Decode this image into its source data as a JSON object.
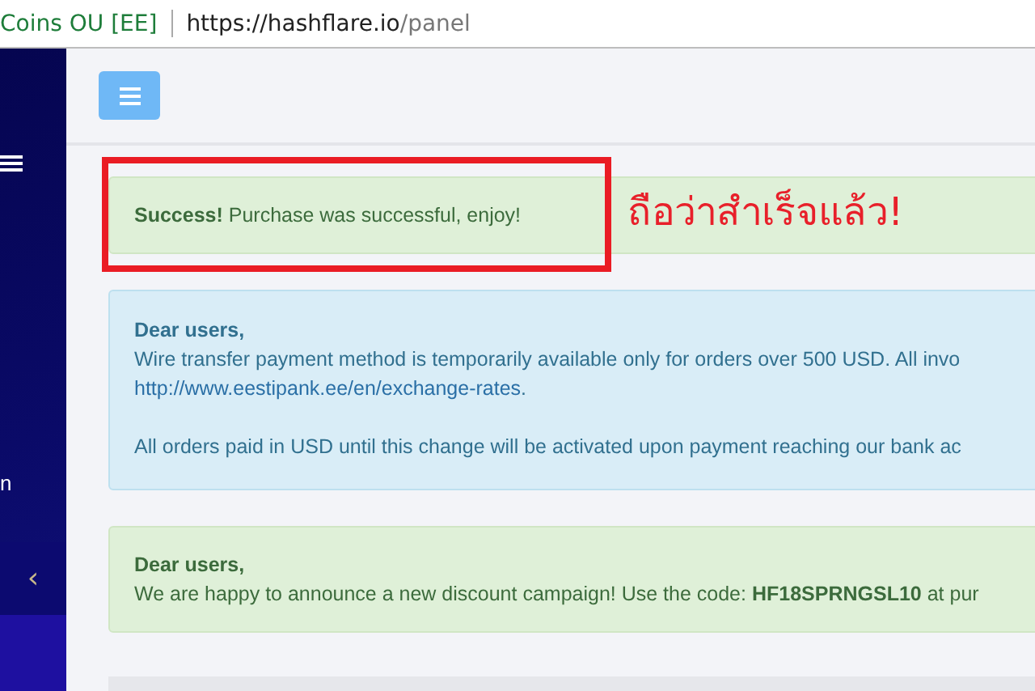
{
  "browser": {
    "site_identity": "Coins OU [EE]",
    "url_host": "https://hashflare.io",
    "url_path": "/panel"
  },
  "sidebar": {
    "label": "n",
    "collapse_glyph": "‹"
  },
  "alerts": [
    {
      "kind": "success",
      "lines": [
        [
          {
            "kind": "text",
            "text": "**Success!** Purchase was successful, enjoy!"
          }
        ]
      ]
    },
    {
      "kind": "info",
      "title": "Dear users,",
      "lines": [
        [
          {
            "kind": "text",
            "text": "Wire transfer payment method is temporarily available only for orders over 500 USD. All invo"
          }
        ],
        [
          {
            "kind": "link",
            "text": "http://www.eestipank.ee/en/exchange-rates"
          },
          {
            "kind": "text",
            "text": "."
          }
        ],
        [
          {
            "kind": "gap"
          }
        ],
        [
          {
            "kind": "text",
            "text": "All orders paid in USD until this change will be activated upon payment reaching our bank ac"
          }
        ]
      ]
    },
    {
      "kind": "success",
      "title": "Dear users,",
      "lines": [
        [
          {
            "kind": "text",
            "text": "We are happy to announce a new discount campaign! Use the code: **HF18SPRNGSL10** at pur"
          }
        ]
      ]
    }
  ],
  "annotation": {
    "text": "ถือว่าสำเร็จแล้ว!"
  }
}
